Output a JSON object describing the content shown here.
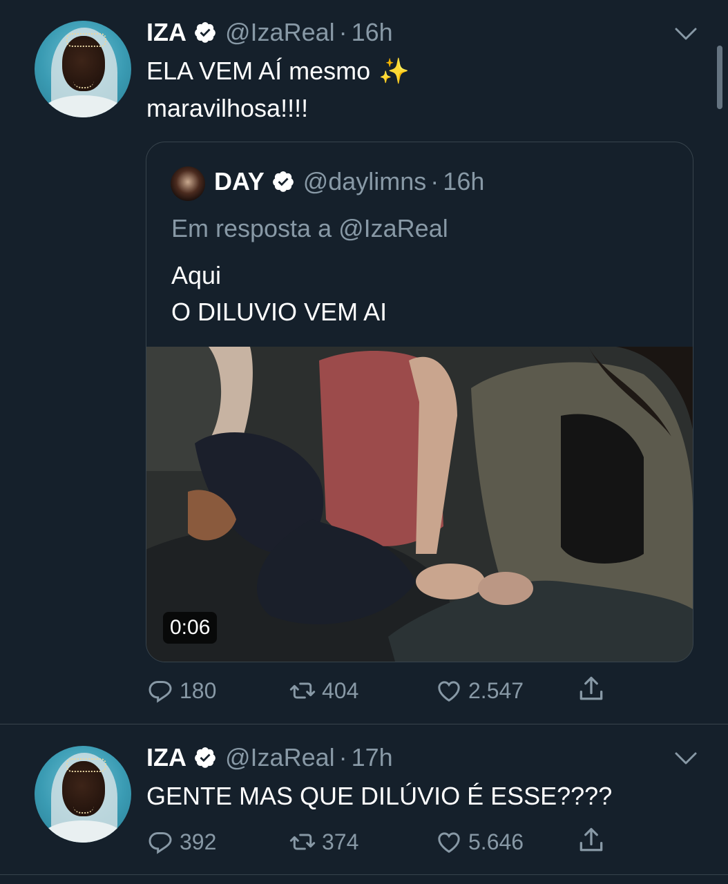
{
  "tweets": [
    {
      "author": {
        "name": "IZA",
        "handle": "@IzaReal",
        "time": "16h",
        "verified": true
      },
      "text_lines": [
        "ELA VEM AÍ mesmo",
        "maravilhosa!!!!"
      ],
      "sparkle_emoji": "✨",
      "quote": {
        "author": {
          "name": "DAY",
          "handle": "@daylimns",
          "time": "16h",
          "verified": true
        },
        "reply_to": "Em resposta a @IzaReal",
        "text_lines": [
          "Aqui",
          "O DILUVIO VEM AI"
        ],
        "video": {
          "duration": "0:06"
        }
      },
      "stats": {
        "replies": "180",
        "retweets": "404",
        "likes": "2.547"
      }
    },
    {
      "author": {
        "name": "IZA",
        "handle": "@IzaReal",
        "time": "17h",
        "verified": true
      },
      "text_lines": [
        "GENTE MAS QUE DILÚVIO É ESSE????"
      ],
      "stats": {
        "replies": "392",
        "retweets": "374",
        "likes": "5.646"
      }
    }
  ],
  "separator_dot": "·",
  "icons": {
    "reply": "reply-icon",
    "retweet": "retweet-icon",
    "like": "like-icon",
    "share": "share-icon",
    "verified": "verified-badge-icon",
    "menu": "chevron-down-icon"
  },
  "colors": {
    "background": "#15202b",
    "secondary_text": "#8899a6",
    "border": "#38444d",
    "primary_text": "#ffffff"
  }
}
